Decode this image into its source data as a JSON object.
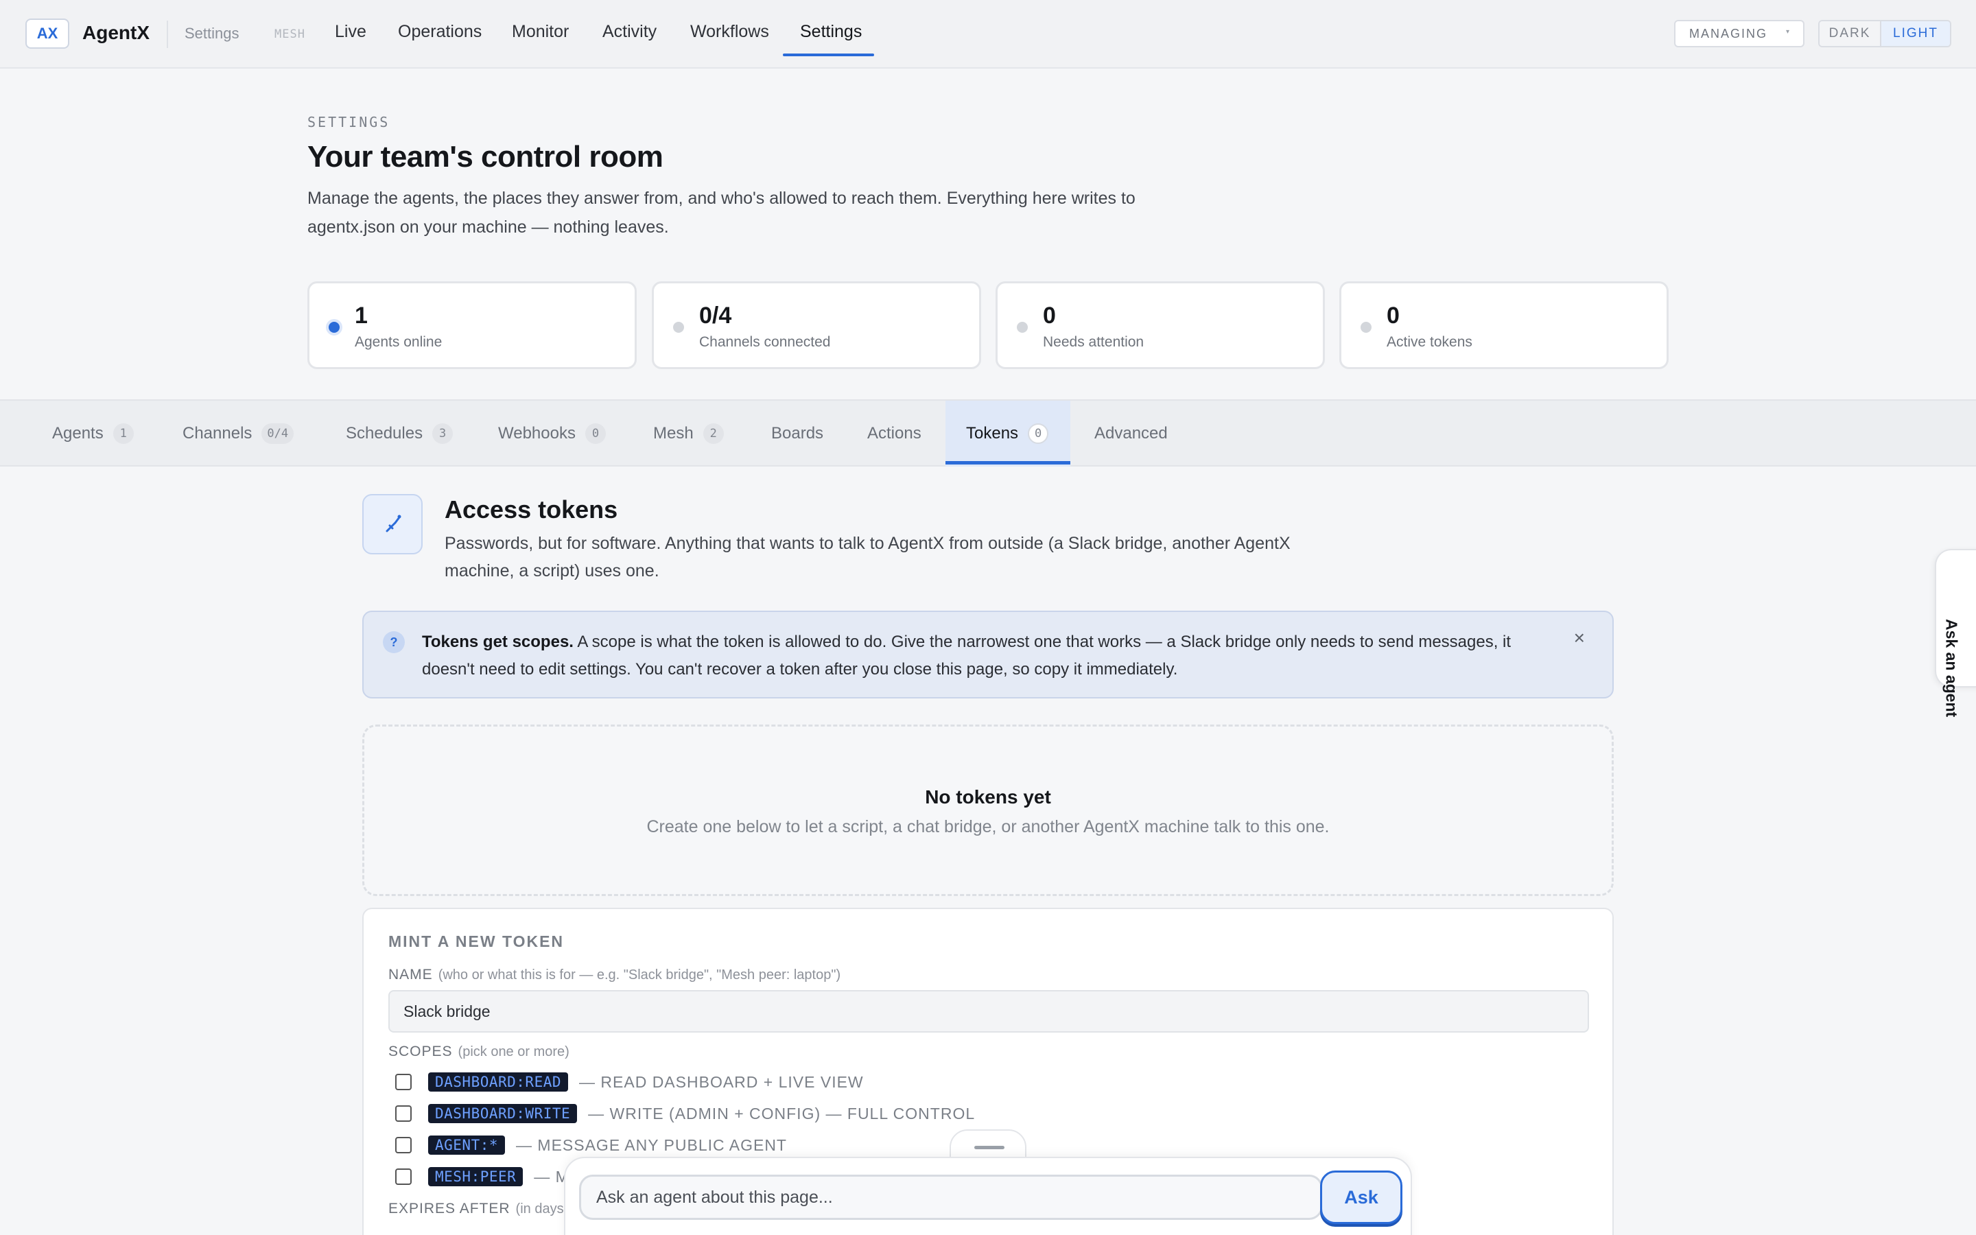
{
  "topbar": {
    "logo": "AX",
    "app_name": "AgentX",
    "crumb": "Settings",
    "mesh_tag": "MESH",
    "nav": [
      {
        "label": "Live"
      },
      {
        "label": "Operations"
      },
      {
        "label": "Monitor"
      },
      {
        "label": "Activity"
      },
      {
        "label": "Workflows"
      },
      {
        "label": "Settings",
        "active": true
      }
    ],
    "managing_label": "MANAGING",
    "theme": {
      "dark": "DARK",
      "light": "LIGHT",
      "selected": "LIGHT"
    }
  },
  "header": {
    "eyebrow": "SETTINGS",
    "title": "Your team's control room",
    "description": "Manage the agents, the places they answer from, and who's allowed to reach them. Everything here writes to agentx.json on your machine — nothing leaves."
  },
  "stats": [
    {
      "value": "1",
      "label": "Agents online",
      "active": true
    },
    {
      "value": "0/4",
      "label": "Channels connected",
      "active": false
    },
    {
      "value": "0",
      "label": "Needs attention",
      "active": false
    },
    {
      "value": "0",
      "label": "Active tokens",
      "active": false
    }
  ],
  "tabs": [
    {
      "label": "Agents",
      "count": "1"
    },
    {
      "label": "Channels",
      "count": "0/4"
    },
    {
      "label": "Schedules",
      "count": "3"
    },
    {
      "label": "Webhooks",
      "count": "0"
    },
    {
      "label": "Mesh",
      "count": "2"
    },
    {
      "label": "Boards"
    },
    {
      "label": "Actions"
    },
    {
      "label": "Tokens",
      "count": "0",
      "active": true
    },
    {
      "label": "Advanced"
    }
  ],
  "tokens": {
    "title": "Access tokens",
    "description": "Passwords, but for software. Anything that wants to talk to AgentX from outside (a Slack bridge, another AgentX machine, a script) uses one.",
    "callout": {
      "bold": "Tokens get scopes.",
      "text": " A scope is what the token is allowed to do. Give the narrowest one that works — a Slack bridge only needs to send messages, it doesn't need to edit settings. You can't recover a token after you close this page, so copy it immediately.",
      "close": "×"
    },
    "empty": {
      "title": "No tokens yet",
      "subtitle": "Create one below to let a script, a chat bridge, or another AgentX machine talk to this one."
    },
    "mint": {
      "title": "MINT A NEW TOKEN",
      "name_label": "NAME",
      "name_hint": "(who or what this is for — e.g. \"Slack bridge\", \"Mesh peer: laptop\")",
      "name_value": "Slack bridge",
      "scopes_label": "SCOPES",
      "scopes_hint": "(pick one or more)",
      "scopes": [
        {
          "code": "DASHBOARD:READ",
          "desc": "— READ DASHBOARD + LIVE VIEW",
          "checked": false
        },
        {
          "code": "DASHBOARD:WRITE",
          "desc": "— WRITE (ADMIN + CONFIG) — FULL CONTROL",
          "checked": false
        },
        {
          "code": "AGENT:*",
          "desc": "— MESSAGE ANY PUBLIC AGENT",
          "checked": false
        },
        {
          "code": "MESH:PEER",
          "desc": "— M",
          "checked": false
        }
      ],
      "expires_label": "EXPIRES AFTER",
      "expires_hint": "(in days"
    }
  },
  "ask": {
    "placeholder": "Ask an agent about this page...",
    "button": "Ask",
    "side_tab": "Ask an agent"
  },
  "colors": {
    "accent": "#2a6bd8",
    "code_bg": "#121a2d",
    "code_fg": "#6ea0ff"
  }
}
